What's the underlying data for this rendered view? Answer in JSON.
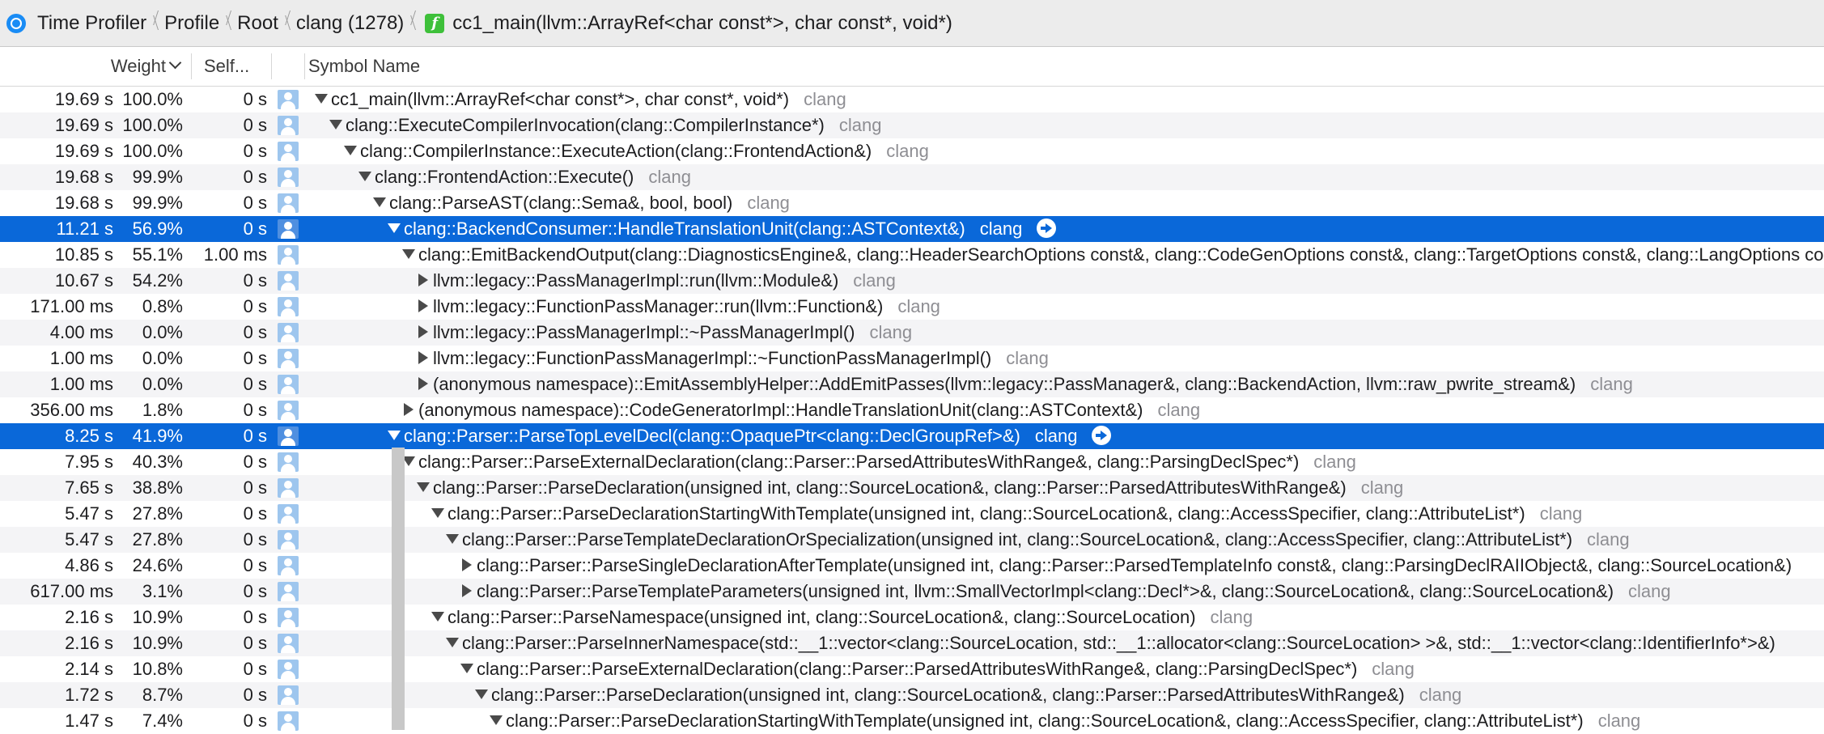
{
  "breadcrumb": {
    "items": [
      "Time Profiler",
      "Profile",
      "Root",
      "clang (1278)"
    ],
    "function": "cc1_main(llvm::ArrayRef<char const*>, char const*, void*)"
  },
  "columns": {
    "weight": "Weight",
    "self": "Self...",
    "symbol": "Symbol Name"
  },
  "rows": [
    {
      "time": "19.69 s",
      "pct": "100.0%",
      "self": "0 s",
      "indent": 0,
      "disc": "down",
      "symbol": "cc1_main(llvm::ArrayRef<char const*>, char const*, void*)",
      "lib": "clang",
      "selected": false
    },
    {
      "time": "19.69 s",
      "pct": "100.0%",
      "self": "0 s",
      "indent": 1,
      "disc": "down",
      "symbol": "clang::ExecuteCompilerInvocation(clang::CompilerInstance*)",
      "lib": "clang",
      "selected": false
    },
    {
      "time": "19.69 s",
      "pct": "100.0%",
      "self": "0 s",
      "indent": 2,
      "disc": "down",
      "symbol": "clang::CompilerInstance::ExecuteAction(clang::FrontendAction&)",
      "lib": "clang",
      "selected": false
    },
    {
      "time": "19.68 s",
      "pct": "99.9%",
      "self": "0 s",
      "indent": 3,
      "disc": "down",
      "symbol": "clang::FrontendAction::Execute()",
      "lib": "clang",
      "selected": false
    },
    {
      "time": "19.68 s",
      "pct": "99.9%",
      "self": "0 s",
      "indent": 4,
      "disc": "down",
      "symbol": "clang::ParseAST(clang::Sema&, bool, bool)",
      "lib": "clang",
      "selected": false
    },
    {
      "time": "11.21 s",
      "pct": "56.9%",
      "self": "0 s",
      "indent": 5,
      "disc": "down",
      "symbol": "clang::BackendConsumer::HandleTranslationUnit(clang::ASTContext&)",
      "lib": "clang",
      "selected": true
    },
    {
      "time": "10.85 s",
      "pct": "55.1%",
      "self": "1.00 ms",
      "indent": 6,
      "disc": "down",
      "symbol": "clang::EmitBackendOutput(clang::DiagnosticsEngine&, clang::HeaderSearchOptions const&, clang::CodeGenOptions const&, clang::TargetOptions const&, clang::LangOptions const&)",
      "lib": "",
      "selected": false
    },
    {
      "time": "10.67 s",
      "pct": "54.2%",
      "self": "0 s",
      "indent": 7,
      "disc": "right",
      "symbol": "llvm::legacy::PassManagerImpl::run(llvm::Module&)",
      "lib": "clang",
      "selected": false
    },
    {
      "time": "171.00 ms",
      "pct": "0.8%",
      "self": "0 s",
      "indent": 7,
      "disc": "right",
      "symbol": "llvm::legacy::FunctionPassManager::run(llvm::Function&)",
      "lib": "clang",
      "selected": false
    },
    {
      "time": "4.00 ms",
      "pct": "0.0%",
      "self": "0 s",
      "indent": 7,
      "disc": "right",
      "symbol": "llvm::legacy::PassManagerImpl::~PassManagerImpl()",
      "lib": "clang",
      "selected": false
    },
    {
      "time": "1.00 ms",
      "pct": "0.0%",
      "self": "0 s",
      "indent": 7,
      "disc": "right",
      "symbol": "llvm::legacy::FunctionPassManagerImpl::~FunctionPassManagerImpl()",
      "lib": "clang",
      "selected": false
    },
    {
      "time": "1.00 ms",
      "pct": "0.0%",
      "self": "0 s",
      "indent": 7,
      "disc": "right",
      "symbol": "(anonymous namespace)::EmitAssemblyHelper::AddEmitPasses(llvm::legacy::PassManager&, clang::BackendAction, llvm::raw_pwrite_stream&)",
      "lib": "clang",
      "selected": false
    },
    {
      "time": "356.00 ms",
      "pct": "1.8%",
      "self": "0 s",
      "indent": 6,
      "disc": "right",
      "symbol": "(anonymous namespace)::CodeGeneratorImpl::HandleTranslationUnit(clang::ASTContext&)",
      "lib": "clang",
      "selected": false
    },
    {
      "time": "8.25 s",
      "pct": "41.9%",
      "self": "0 s",
      "indent": 5,
      "disc": "down",
      "symbol": "clang::Parser::ParseTopLevelDecl(clang::OpaquePtr<clang::DeclGroupRef>&)",
      "lib": "clang",
      "selected": true
    },
    {
      "time": "7.95 s",
      "pct": "40.3%",
      "self": "0 s",
      "indent": 6,
      "disc": "down",
      "symbol": "clang::Parser::ParseExternalDeclaration(clang::Parser::ParsedAttributesWithRange&, clang::ParsingDeclSpec*)",
      "lib": "clang",
      "selected": false
    },
    {
      "time": "7.65 s",
      "pct": "38.8%",
      "self": "0 s",
      "indent": 7,
      "disc": "down",
      "symbol": "clang::Parser::ParseDeclaration(unsigned int, clang::SourceLocation&, clang::Parser::ParsedAttributesWithRange&)",
      "lib": "clang",
      "selected": false
    },
    {
      "time": "5.47 s",
      "pct": "27.8%",
      "self": "0 s",
      "indent": 8,
      "disc": "down",
      "symbol": "clang::Parser::ParseDeclarationStartingWithTemplate(unsigned int, clang::SourceLocation&, clang::AccessSpecifier, clang::AttributeList*)",
      "lib": "clang",
      "selected": false
    },
    {
      "time": "5.47 s",
      "pct": "27.8%",
      "self": "0 s",
      "indent": 9,
      "disc": "down",
      "symbol": "clang::Parser::ParseTemplateDeclarationOrSpecialization(unsigned int, clang::SourceLocation&, clang::AccessSpecifier, clang::AttributeList*)",
      "lib": "clang",
      "selected": false
    },
    {
      "time": "4.86 s",
      "pct": "24.6%",
      "self": "0 s",
      "indent": 10,
      "disc": "right",
      "symbol": "clang::Parser::ParseSingleDeclarationAfterTemplate(unsigned int, clang::Parser::ParsedTemplateInfo const&, clang::ParsingDeclRAIIObject&, clang::SourceLocation&)",
      "lib": "",
      "selected": false
    },
    {
      "time": "617.00 ms",
      "pct": "3.1%",
      "self": "0 s",
      "indent": 10,
      "disc": "right",
      "symbol": "clang::Parser::ParseTemplateParameters(unsigned int, llvm::SmallVectorImpl<clang::Decl*>&, clang::SourceLocation&, clang::SourceLocation&)",
      "lib": "clang",
      "selected": false
    },
    {
      "time": "2.16 s",
      "pct": "10.9%",
      "self": "0 s",
      "indent": 8,
      "disc": "down",
      "symbol": "clang::Parser::ParseNamespace(unsigned int, clang::SourceLocation&, clang::SourceLocation)",
      "lib": "clang",
      "selected": false
    },
    {
      "time": "2.16 s",
      "pct": "10.9%",
      "self": "0 s",
      "indent": 9,
      "disc": "down",
      "symbol": "clang::Parser::ParseInnerNamespace(std::__1::vector<clang::SourceLocation, std::__1::allocator<clang::SourceLocation> >&, std::__1::vector<clang::IdentifierInfo*>&)",
      "lib": "",
      "selected": false
    },
    {
      "time": "2.14 s",
      "pct": "10.8%",
      "self": "0 s",
      "indent": 10,
      "disc": "down",
      "symbol": "clang::Parser::ParseExternalDeclaration(clang::Parser::ParsedAttributesWithRange&, clang::ParsingDeclSpec*)",
      "lib": "clang",
      "selected": false
    },
    {
      "time": "1.72 s",
      "pct": "8.7%",
      "self": "0 s",
      "indent": 11,
      "disc": "down",
      "symbol": "clang::Parser::ParseDeclaration(unsigned int, clang::SourceLocation&, clang::Parser::ParsedAttributesWithRange&)",
      "lib": "clang",
      "selected": false
    },
    {
      "time": "1.47 s",
      "pct": "7.4%",
      "self": "0 s",
      "indent": 12,
      "disc": "down",
      "symbol": "clang::Parser::ParseDeclarationStartingWithTemplate(unsigned int, clang::SourceLocation&, clang::AccessSpecifier, clang::AttributeList*)",
      "lib": "clang",
      "selected": false
    }
  ]
}
